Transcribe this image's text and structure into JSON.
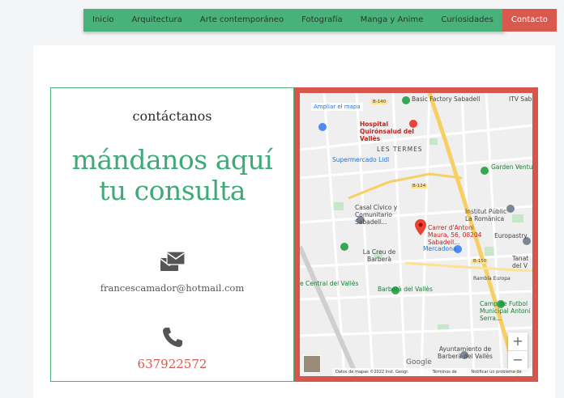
{
  "nav": {
    "items": [
      {
        "label": "Inicio"
      },
      {
        "label": "Arquitectura"
      },
      {
        "label": "Arte contemporáneo"
      },
      {
        "label": "Fotografía"
      },
      {
        "label": "Manga y Anime"
      },
      {
        "label": "Curiosidades"
      },
      {
        "label": "Contacto",
        "active": true
      }
    ]
  },
  "contact": {
    "title": "contáctanos",
    "headline_line1": "mándanos aquí",
    "headline_line2": "tu consulta",
    "email": "francescamador@hotmail.com",
    "phone": "637922572",
    "mail_icon": "mail-icon",
    "phone_icon": "phone-icon"
  },
  "map": {
    "enlarge_link": "Ampliar el mapa",
    "labels": {
      "basic_factory": "Basic Factory Sabadell",
      "itv": "ITV Sab",
      "hospital": "Hospital Quirónsalud del Vallès",
      "les_termes": "LES TERMES",
      "supermercado": "Supermercado Lidl",
      "garden": "Garden Ventura - Viveros",
      "casal": "Casal Cívico y Comunitario Sabadell...",
      "instituto": "Institut Públic La Romànica",
      "europastry": "Europastry",
      "destination": "Carrer d'Antoni Maura, 56, 08204 Sabadell...",
      "la_creu": "La Creu de Barberà",
      "mercadona": "Mercadona",
      "central": "e Central del Vallès",
      "barbera": "Barberà del Vallès",
      "camp": "Camp de Futbol Municipal Antoni Serra...",
      "ayuntamiento": "Ayuntamiento de Barberà del Vallès",
      "tanatorio": "Tanat del V",
      "rambla": "Rambla Europa",
      "road_b140": "B-140",
      "road_b150": "B-150",
      "road_b124": "B-124"
    },
    "footer": {
      "data": "Datos de mapas ©2022 Inst. Geogr. Nacional",
      "terms": "Términos de uso",
      "report": "Notificar un problema de Maps"
    },
    "google": "Google",
    "zoom_in": "+",
    "zoom_out": "−"
  },
  "colors": {
    "nav_bg": "#48b27a",
    "active": "#d9594e",
    "headline": "#3daa78",
    "phone": "#d9594e"
  }
}
